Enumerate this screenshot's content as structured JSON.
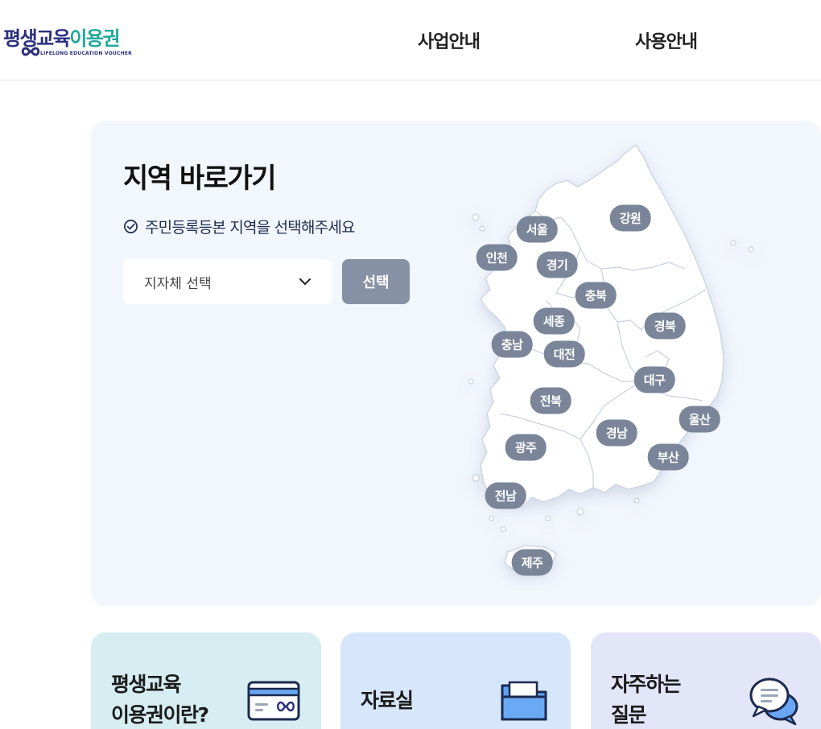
{
  "header": {
    "logo": {
      "main_part1": "평생교육",
      "main_part2": "이용권",
      "sub": "LIFELONG EDUCATION VOUCHER"
    },
    "nav": [
      "사업안내",
      "사용안내"
    ]
  },
  "region": {
    "title": "지역 바로가기",
    "notice": "주민등록등본 지역을 선택해주세요",
    "select_placeholder": "지자체 선택",
    "select_button": "선택",
    "regions": [
      "서울",
      "인천",
      "경기",
      "강원",
      "충북",
      "세종",
      "충남",
      "대전",
      "경북",
      "대구",
      "전북",
      "울산",
      "경남",
      "광주",
      "부산",
      "전남",
      "제주"
    ]
  },
  "cards": [
    {
      "line1": "평생교육",
      "line2": "이용권이란?",
      "bg": "#d6edf2",
      "icon": "voucher-card-icon"
    },
    {
      "line1": "자료실",
      "line2": "",
      "bg": "#d6e7fb",
      "icon": "folder-icon"
    },
    {
      "line1": "자주하는",
      "line2": "질문",
      "bg": "#e3e5f9",
      "icon": "chat-bubble-icon"
    }
  ],
  "colors": {
    "brand_teal": "#21a99b",
    "brand_navy": "#2c2f7f",
    "badge": "#7a8599",
    "button": "#8791a5",
    "panel_bg": "#f2f6fd"
  }
}
